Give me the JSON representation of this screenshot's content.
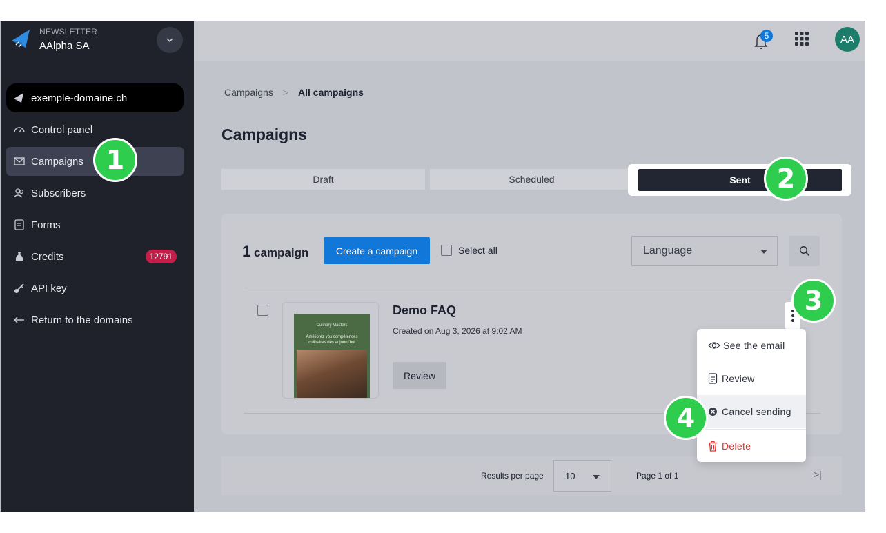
{
  "brand": {
    "kicker": "NEWSLETTER",
    "name": "AAlpha SA"
  },
  "sidebar": {
    "domain": "exemple-domaine.ch",
    "items": [
      {
        "label": "Control panel",
        "icon": "gauge-icon"
      },
      {
        "label": "Campaigns",
        "icon": "envelope-icon",
        "active": true
      },
      {
        "label": "Subscribers",
        "icon": "users-icon"
      },
      {
        "label": "Forms",
        "icon": "document-icon"
      },
      {
        "label": "Credits",
        "icon": "money-bag-icon",
        "badge": "12791"
      },
      {
        "label": "API key",
        "icon": "key-icon"
      },
      {
        "label": "Return to the domains",
        "icon": "arrow-left-icon"
      }
    ]
  },
  "topbar": {
    "notifications_count": "5",
    "avatar_initials": "AA"
  },
  "breadcrumb": {
    "parent": "Campaigns",
    "separator": ">",
    "current": "All campaigns"
  },
  "page": {
    "title": "Campaigns"
  },
  "tabs": [
    {
      "label": "Draft"
    },
    {
      "label": "Scheduled"
    },
    {
      "label": "Sent",
      "active": true
    }
  ],
  "toolbar": {
    "count_number": "1",
    "count_label": "campaign",
    "create_label": "Create a campaign",
    "select_all_label": "Select all",
    "language_placeholder": "Language"
  },
  "campaign": {
    "name": "Demo FAQ",
    "created": "Created on Aug 3, 2026 at 9:02 AM",
    "review_label": "Review",
    "thumbnail_brand": "Culinary Masters",
    "thumbnail_text": "Améliorez vos compétences culinaires dès aujourd'hui"
  },
  "menu": {
    "items": [
      {
        "label": "See the email",
        "icon": "eye-icon"
      },
      {
        "label": "Review",
        "icon": "document-icon"
      },
      {
        "label": "Cancel sending",
        "icon": "x-circle-icon"
      },
      {
        "label": "Delete",
        "icon": "trash-icon"
      }
    ]
  },
  "pagination": {
    "results_per_page_label": "Results per page",
    "results_per_page_value": "10",
    "page_label": "Page 1 of 1"
  },
  "callouts": [
    "1",
    "2",
    "3",
    "4"
  ],
  "colors": {
    "accent": "#1178d9",
    "sidebar": "#1f222a",
    "callout": "#2fcd4d",
    "danger": "#e2322d",
    "credit_badge": "#c41e4a"
  }
}
